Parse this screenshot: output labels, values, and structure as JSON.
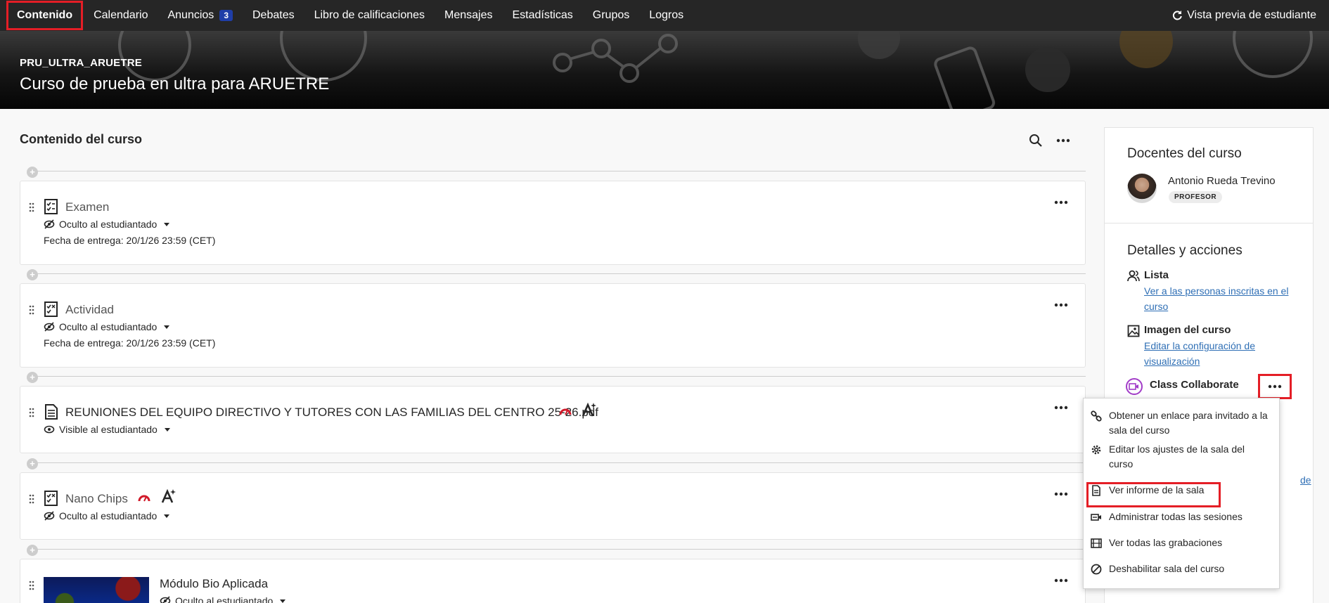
{
  "nav": {
    "tabs": [
      {
        "label": "Contenido",
        "active": true
      },
      {
        "label": "Calendario"
      },
      {
        "label": "Anuncios",
        "badge": "3"
      },
      {
        "label": "Debates"
      },
      {
        "label": "Libro de calificaciones"
      },
      {
        "label": "Mensajes"
      },
      {
        "label": "Estadísticas"
      },
      {
        "label": "Grupos"
      },
      {
        "label": "Logros"
      }
    ],
    "preview_label": "Vista previa de estudiante"
  },
  "banner": {
    "course_code": "PRU_ULTRA_ARUETRE",
    "course_title": "Curso de prueba en ultra para ARUETRE"
  },
  "main": {
    "title": "Contenido del curso",
    "items": [
      {
        "title": "Examen",
        "visibility": "Oculto al estudiantado",
        "due": "Fecha de entrega: 20/1/26 23:59 (CET)",
        "icon": "test-icon"
      },
      {
        "title": "Actividad",
        "visibility": "Oculto al estudiantado",
        "due": "Fecha de entrega: 20/1/26 23:59 (CET)",
        "icon": "assignment-icon"
      },
      {
        "title": "REUNIONES DEL EQUIPO DIRECTIVO Y TUTORES CON LAS FAMILIAS DEL CENTRO 25-26.pdf",
        "visibility": "Visible al estudiantado",
        "icon": "document-icon"
      },
      {
        "title": "Nano Chips",
        "visibility": "Oculto al estudiantado",
        "icon": "assignment-icon"
      },
      {
        "title": "Módulo Bio Aplicada",
        "visibility": "Oculto al estudiantado",
        "icon": "module-thumbnail"
      }
    ]
  },
  "panel": {
    "teachers_heading": "Docentes del curso",
    "teacher_name": "Antonio Rueda Trevino",
    "teacher_role": "PROFESOR",
    "details_heading": "Detalles y acciones",
    "roster_label": "Lista",
    "roster_link": "Ver a las personas inscritas en el curso",
    "image_label": "Imagen del curso",
    "image_link": "Editar la configuración de visualización",
    "collab_label": "Class Collaborate",
    "partial_link": "de"
  },
  "menu": {
    "items": [
      {
        "label": "Obtener un enlace para invitado a la sala del curso",
        "icon": "link-icon"
      },
      {
        "label": "Editar los ajustes de la sala del curso",
        "icon": "gear-icon"
      },
      {
        "label": "Ver informe de la sala",
        "icon": "report-icon",
        "highlighted": true
      },
      {
        "label": "Administrar todas las sesiones",
        "icon": "video-icon"
      },
      {
        "label": "Ver todas las grabaciones",
        "icon": "film-icon"
      },
      {
        "label": "Deshabilitar sala del curso",
        "icon": "disable-icon"
      }
    ]
  },
  "colors": {
    "accent_red": "#e41e26",
    "badge_blue": "#1f3ea8",
    "link_blue": "#2f6fb5",
    "collab_purple": "#a23cc8"
  }
}
